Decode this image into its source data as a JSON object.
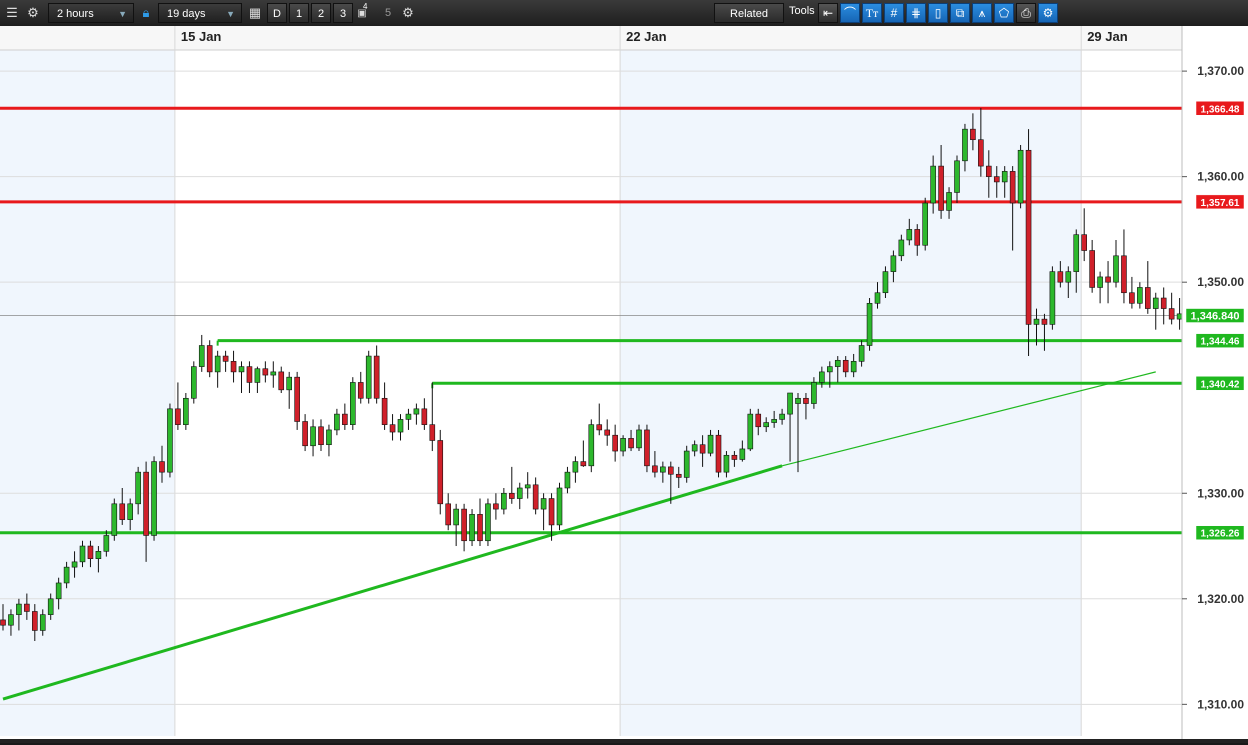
{
  "toolbar": {
    "timeframe": "2 hours",
    "range": "19 days",
    "buttons": [
      "D",
      "1",
      "2",
      "3",
      "5"
    ],
    "superscript": "4",
    "related_label": "Related",
    "tools_label": "Tools"
  },
  "colors": {
    "up": "#2db82d",
    "down": "#d0202a",
    "support": "#1fb81f",
    "resistance": "#e8191c",
    "shade": "#f0f6fd"
  },
  "chart_data": {
    "type": "candlestick",
    "x_labels": [
      {
        "label": "15 Jan",
        "bar": 22
      },
      {
        "label": "22 Jan",
        "bar": 78
      },
      {
        "label": "29 Jan",
        "bar": 136
      }
    ],
    "y_axis": {
      "ticks": [
        "1,310.00",
        "1,320.00",
        "1,330.00",
        "1,350.00",
        "1,360.00",
        "1,370.00"
      ],
      "tick_values": [
        1310,
        1320,
        1330,
        1350,
        1360,
        1370
      ],
      "range": [
        1307,
        1372
      ]
    },
    "current_price": {
      "label": "1,346.840",
      "value": 1346.84
    },
    "horizontal_lines": [
      {
        "label": "1,366.48",
        "value": 1366.48,
        "kind": "resistance",
        "from_bar": 0
      },
      {
        "label": "1,357.61",
        "value": 1357.61,
        "kind": "resistance",
        "from_bar": 0
      },
      {
        "label": "1,344.46",
        "value": 1344.46,
        "kind": "support",
        "from_bar": 27
      },
      {
        "label": "1,340.42",
        "value": 1340.42,
        "kind": "support",
        "from_bar": 54
      },
      {
        "label": "1,326.26",
        "value": 1326.26,
        "kind": "support",
        "from_bar": 0
      }
    ],
    "trendlines": [
      {
        "from": {
          "bar": 0,
          "value": 1310.5
        },
        "to": {
          "bar": 98,
          "value": 1332.6
        },
        "weight": "thick"
      },
      {
        "from": {
          "bar": 98,
          "value": 1332.6
        },
        "to": {
          "bar": 145,
          "value": 1341.5
        },
        "weight": "thin"
      }
    ],
    "candles": [
      [
        1318,
        1319.5,
        1317,
        1317.5
      ],
      [
        1317.5,
        1319,
        1316.5,
        1318.5
      ],
      [
        1318.5,
        1320,
        1317,
        1319.5
      ],
      [
        1319.5,
        1320.5,
        1318,
        1318.8
      ],
      [
        1318.8,
        1319.5,
        1316,
        1317
      ],
      [
        1317,
        1319,
        1316.5,
        1318.5
      ],
      [
        1318.5,
        1320.5,
        1318,
        1320
      ],
      [
        1320,
        1322,
        1319,
        1321.5
      ],
      [
        1321.5,
        1323.5,
        1321,
        1323
      ],
      [
        1323,
        1324.5,
        1322,
        1323.5
      ],
      [
        1323.5,
        1325.5,
        1323,
        1325
      ],
      [
        1325,
        1325.5,
        1323,
        1323.8
      ],
      [
        1323.8,
        1325,
        1322.5,
        1324.5
      ],
      [
        1324.5,
        1326.5,
        1324,
        1326
      ],
      [
        1326,
        1329.5,
        1325.5,
        1329
      ],
      [
        1329,
        1330.5,
        1327,
        1327.5
      ],
      [
        1327.5,
        1329.5,
        1326.5,
        1329
      ],
      [
        1329,
        1332.5,
        1328,
        1332
      ],
      [
        1332,
        1333,
        1323.5,
        1326
      ],
      [
        1326,
        1333.5,
        1325.5,
        1333
      ],
      [
        1333,
        1334.5,
        1331,
        1332
      ],
      [
        1332,
        1338.5,
        1331.5,
        1338
      ],
      [
        1338,
        1340.5,
        1336,
        1336.5
      ],
      [
        1336.5,
        1339.5,
        1336,
        1339
      ],
      [
        1339,
        1342.5,
        1338.5,
        1342
      ],
      [
        1342,
        1345,
        1341.5,
        1344
      ],
      [
        1344,
        1344.5,
        1341,
        1341.5
      ],
      [
        1341.5,
        1343.5,
        1340,
        1343
      ],
      [
        1343,
        1343.5,
        1341.5,
        1342.5
      ],
      [
        1342.5,
        1343.5,
        1340.5,
        1341.5
      ],
      [
        1341.5,
        1342.5,
        1339.5,
        1342
      ],
      [
        1342,
        1342.5,
        1339.5,
        1340.5
      ],
      [
        1340.5,
        1342,
        1339.5,
        1341.8
      ],
      [
        1341.8,
        1342.5,
        1340.5,
        1341.2
      ],
      [
        1341.2,
        1342.5,
        1340,
        1341.5
      ],
      [
        1341.5,
        1342,
        1339.5,
        1339.8
      ],
      [
        1339.8,
        1341.5,
        1338,
        1341
      ],
      [
        1341,
        1341.5,
        1336,
        1336.8
      ],
      [
        1336.8,
        1337.5,
        1334,
        1334.5
      ],
      [
        1334.5,
        1337,
        1333.5,
        1336.3
      ],
      [
        1336.3,
        1337,
        1334,
        1334.6
      ],
      [
        1334.6,
        1336.5,
        1333.5,
        1336
      ],
      [
        1336,
        1338,
        1335.5,
        1337.5
      ],
      [
        1337.5,
        1338.5,
        1336,
        1336.5
      ],
      [
        1336.5,
        1341,
        1336,
        1340.5
      ],
      [
        1340.5,
        1341.5,
        1338.5,
        1339
      ],
      [
        1339,
        1343.5,
        1338.5,
        1343
      ],
      [
        1343,
        1344,
        1338.5,
        1339
      ],
      [
        1339,
        1340.5,
        1336,
        1336.5
      ],
      [
        1336.5,
        1337.5,
        1335,
        1335.8
      ],
      [
        1335.8,
        1337.5,
        1335,
        1337
      ],
      [
        1337,
        1338,
        1336,
        1337.5
      ],
      [
        1337.5,
        1338.5,
        1336.5,
        1338
      ],
      [
        1338,
        1339,
        1336,
        1336.5
      ],
      [
        1336.5,
        1340.5,
        1334,
        1335
      ],
      [
        1335,
        1336,
        1328,
        1329
      ],
      [
        1329,
        1330,
        1326.5,
        1327
      ],
      [
        1327,
        1329,
        1325,
        1328.5
      ],
      [
        1328.5,
        1329,
        1324.5,
        1325.5
      ],
      [
        1325.5,
        1328.5,
        1325,
        1328
      ],
      [
        1328,
        1329.5,
        1325,
        1325.5
      ],
      [
        1325.5,
        1329.5,
        1325,
        1329
      ],
      [
        1329,
        1330,
        1327.5,
        1328.5
      ],
      [
        1328.5,
        1330.5,
        1328,
        1330
      ],
      [
        1330,
        1332.5,
        1329,
        1329.5
      ],
      [
        1329.5,
        1331,
        1328.5,
        1330.5
      ],
      [
        1330.5,
        1332,
        1329.5,
        1330.8
      ],
      [
        1330.8,
        1331.5,
        1328,
        1328.5
      ],
      [
        1328.5,
        1330,
        1326.5,
        1329.5
      ],
      [
        1329.5,
        1330,
        1325.5,
        1327
      ],
      [
        1327,
        1331,
        1326.5,
        1330.5
      ],
      [
        1330.5,
        1332.5,
        1330,
        1332
      ],
      [
        1332,
        1333.5,
        1331,
        1333
      ],
      [
        1333,
        1335,
        1332.5,
        1332.6
      ],
      [
        1332.6,
        1337,
        1332,
        1336.5
      ],
      [
        1336.5,
        1338.5,
        1335.5,
        1336
      ],
      [
        1336,
        1337,
        1334.5,
        1335.5
      ],
      [
        1335.5,
        1336.5,
        1333,
        1334
      ],
      [
        1334,
        1335.5,
        1333.5,
        1335.2
      ],
      [
        1335.2,
        1336,
        1334,
        1334.3
      ],
      [
        1334.3,
        1336.5,
        1334,
        1336
      ],
      [
        1336,
        1336.5,
        1332,
        1332.6
      ],
      [
        1332.6,
        1334,
        1331.5,
        1332
      ],
      [
        1332,
        1333,
        1331,
        1332.5
      ],
      [
        1332.5,
        1333,
        1329,
        1331.8
      ],
      [
        1331.8,
        1332.5,
        1330.5,
        1331.5
      ],
      [
        1331.5,
        1334.5,
        1331,
        1334
      ],
      [
        1334,
        1335,
        1333.5,
        1334.6
      ],
      [
        1334.6,
        1335.5,
        1332.5,
        1333.8
      ],
      [
        1333.8,
        1336,
        1333.5,
        1335.5
      ],
      [
        1335.5,
        1336,
        1331.5,
        1332
      ],
      [
        1332,
        1334,
        1331.5,
        1333.6
      ],
      [
        1333.6,
        1334,
        1332.5,
        1333.2
      ],
      [
        1333.2,
        1335,
        1333,
        1334.2
      ],
      [
        1334.2,
        1338,
        1334,
        1337.5
      ],
      [
        1337.5,
        1338,
        1335.5,
        1336.3
      ],
      [
        1336.3,
        1337.2,
        1335.8,
        1336.7
      ],
      [
        1336.7,
        1337.8,
        1336.2,
        1337
      ],
      [
        1337,
        1338,
        1336.5,
        1337.5
      ],
      [
        1337.5,
        1339,
        1333,
        1339.5
      ],
      [
        1338.5,
        1339.5,
        1332,
        1339
      ],
      [
        1339,
        1339.5,
        1337,
        1338.5
      ],
      [
        1338.5,
        1341,
        1338,
        1340.5
      ],
      [
        1340.5,
        1342,
        1340,
        1341.5
      ],
      [
        1341.5,
        1342.5,
        1340,
        1342
      ],
      [
        1342,
        1343,
        1340.5,
        1342.6
      ],
      [
        1342.6,
        1343,
        1341,
        1341.5
      ],
      [
        1341.5,
        1343.2,
        1341,
        1342.5
      ],
      [
        1342.5,
        1344.5,
        1342,
        1344
      ],
      [
        1344,
        1348.5,
        1343.5,
        1348
      ],
      [
        1348,
        1350,
        1347.5,
        1349
      ],
      [
        1349,
        1351.5,
        1348.5,
        1351
      ],
      [
        1351,
        1353,
        1350,
        1352.5
      ],
      [
        1352.5,
        1354.5,
        1352,
        1354
      ],
      [
        1354,
        1356,
        1353.5,
        1355
      ],
      [
        1355,
        1355.5,
        1352.5,
        1353.5
      ],
      [
        1353.5,
        1358,
        1353,
        1357.5
      ],
      [
        1357.5,
        1362,
        1356.5,
        1361
      ],
      [
        1361,
        1363,
        1356,
        1356.8
      ],
      [
        1356.8,
        1359,
        1356,
        1358.5
      ],
      [
        1358.5,
        1362,
        1357.5,
        1361.5
      ],
      [
        1361.5,
        1365,
        1360.5,
        1364.5
      ],
      [
        1364.5,
        1366,
        1362.5,
        1363.5
      ],
      [
        1363.5,
        1366.5,
        1360,
        1361
      ],
      [
        1361,
        1362.5,
        1358,
        1360
      ],
      [
        1360,
        1361,
        1358,
        1359.5
      ],
      [
        1359.5,
        1361,
        1358,
        1360.5
      ],
      [
        1360.5,
        1361,
        1353,
        1357.5
      ],
      [
        1357.5,
        1363,
        1357,
        1362.5
      ],
      [
        1362.5,
        1364.5,
        1343,
        1346
      ],
      [
        1346,
        1347.5,
        1344,
        1346.5
      ],
      [
        1346.5,
        1347,
        1343.5,
        1346
      ],
      [
        1346,
        1351.5,
        1345.5,
        1351
      ],
      [
        1351,
        1352,
        1349.5,
        1350
      ],
      [
        1350,
        1351.5,
        1348.5,
        1351
      ],
      [
        1351,
        1355,
        1349,
        1354.5
      ],
      [
        1354.5,
        1357,
        1352,
        1353
      ],
      [
        1353,
        1354,
        1349,
        1349.5
      ],
      [
        1349.5,
        1351,
        1348,
        1350.5
      ],
      [
        1350.5,
        1352,
        1348,
        1350
      ],
      [
        1350,
        1354,
        1349.5,
        1352.5
      ],
      [
        1352.5,
        1355,
        1348,
        1349
      ],
      [
        1349,
        1350.5,
        1347.5,
        1348
      ],
      [
        1348,
        1350,
        1347.5,
        1349.5
      ],
      [
        1349.5,
        1352,
        1347,
        1347.5
      ],
      [
        1347.5,
        1349,
        1345.5,
        1348.5
      ],
      [
        1348.5,
        1349.5,
        1346,
        1347.5
      ],
      [
        1347.5,
        1349,
        1346,
        1346.5
      ],
      [
        1346.5,
        1348.5,
        1345.5,
        1347
      ],
      [
        1347,
        1348,
        1345,
        1345.5
      ],
      [
        1345.5,
        1346.5,
        1345,
        1346
      ]
    ]
  }
}
